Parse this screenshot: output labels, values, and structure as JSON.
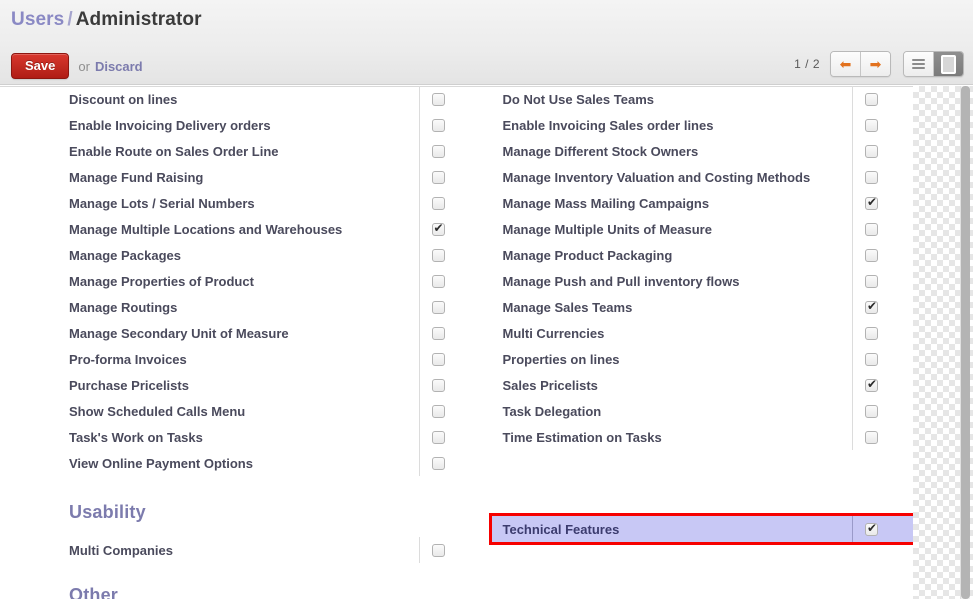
{
  "breadcrumb": {
    "parent": "Users",
    "separator": "/",
    "current": "Administrator"
  },
  "toolbar": {
    "save_label": "Save",
    "or_label": "or",
    "discard_label": "Discard"
  },
  "pager": {
    "count": "1 / 2",
    "prev_icon": "arrow-left-icon",
    "next_icon": "arrow-right-icon",
    "prev_glyph": "⬅",
    "next_glyph": "➡"
  },
  "view_switcher": {
    "list_view": "list-view-icon",
    "form_view": "form-view-icon",
    "active": "form_view"
  },
  "accent_colors": {
    "breadcrumb_link": "#8a89c4",
    "section_heading": "#7c7bad",
    "save_button": "#c32b22",
    "discard_link": "#7c7bad",
    "highlight_background": "#c8c8f5",
    "highlight_border": "#f60000"
  },
  "features": {
    "left_column": [
      {
        "label": "Discount on lines",
        "checked": false
      },
      {
        "label": "Enable Invoicing Delivery orders",
        "checked": false
      },
      {
        "label": "Enable Route on Sales Order Line",
        "checked": false
      },
      {
        "label": "Manage Fund Raising",
        "checked": false
      },
      {
        "label": "Manage Lots / Serial Numbers",
        "checked": false
      },
      {
        "label": "Manage Multiple Locations and Warehouses",
        "checked": true
      },
      {
        "label": "Manage Packages",
        "checked": false
      },
      {
        "label": "Manage Properties of Product",
        "checked": false
      },
      {
        "label": "Manage Routings",
        "checked": false
      },
      {
        "label": "Manage Secondary Unit of Measure",
        "checked": false
      },
      {
        "label": "Pro-forma Invoices",
        "checked": false
      },
      {
        "label": "Purchase Pricelists",
        "checked": false
      },
      {
        "label": "Show Scheduled Calls Menu",
        "checked": false
      },
      {
        "label": "Task's Work on Tasks",
        "checked": false
      },
      {
        "label": "View Online Payment Options",
        "checked": false
      }
    ],
    "right_column": [
      {
        "label": "Do Not Use Sales Teams",
        "checked": false
      },
      {
        "label": "Enable Invoicing Sales order lines",
        "checked": false
      },
      {
        "label": "Manage Different Stock Owners",
        "checked": false
      },
      {
        "label": "Manage Inventory Valuation and Costing Methods",
        "checked": false
      },
      {
        "label": "Manage Mass Mailing Campaigns",
        "checked": true
      },
      {
        "label": "Manage Multiple Units of Measure",
        "checked": false
      },
      {
        "label": "Manage Product Packaging",
        "checked": false
      },
      {
        "label": "Manage Push and Pull inventory flows",
        "checked": false
      },
      {
        "label": "Manage Sales Teams",
        "checked": true
      },
      {
        "label": "Multi Currencies",
        "checked": false
      },
      {
        "label": "Properties on lines",
        "checked": false
      },
      {
        "label": "Sales Pricelists",
        "checked": true
      },
      {
        "label": "Task Delegation",
        "checked": false
      },
      {
        "label": "Time Estimation on Tasks",
        "checked": false
      }
    ]
  },
  "usability": {
    "title": "Usability",
    "left_column": [
      {
        "label": "Multi Companies",
        "checked": false
      }
    ],
    "right_column": [
      {
        "label": "Technical Features",
        "checked": true,
        "highlighted": true
      }
    ]
  },
  "other": {
    "title": "Other"
  }
}
